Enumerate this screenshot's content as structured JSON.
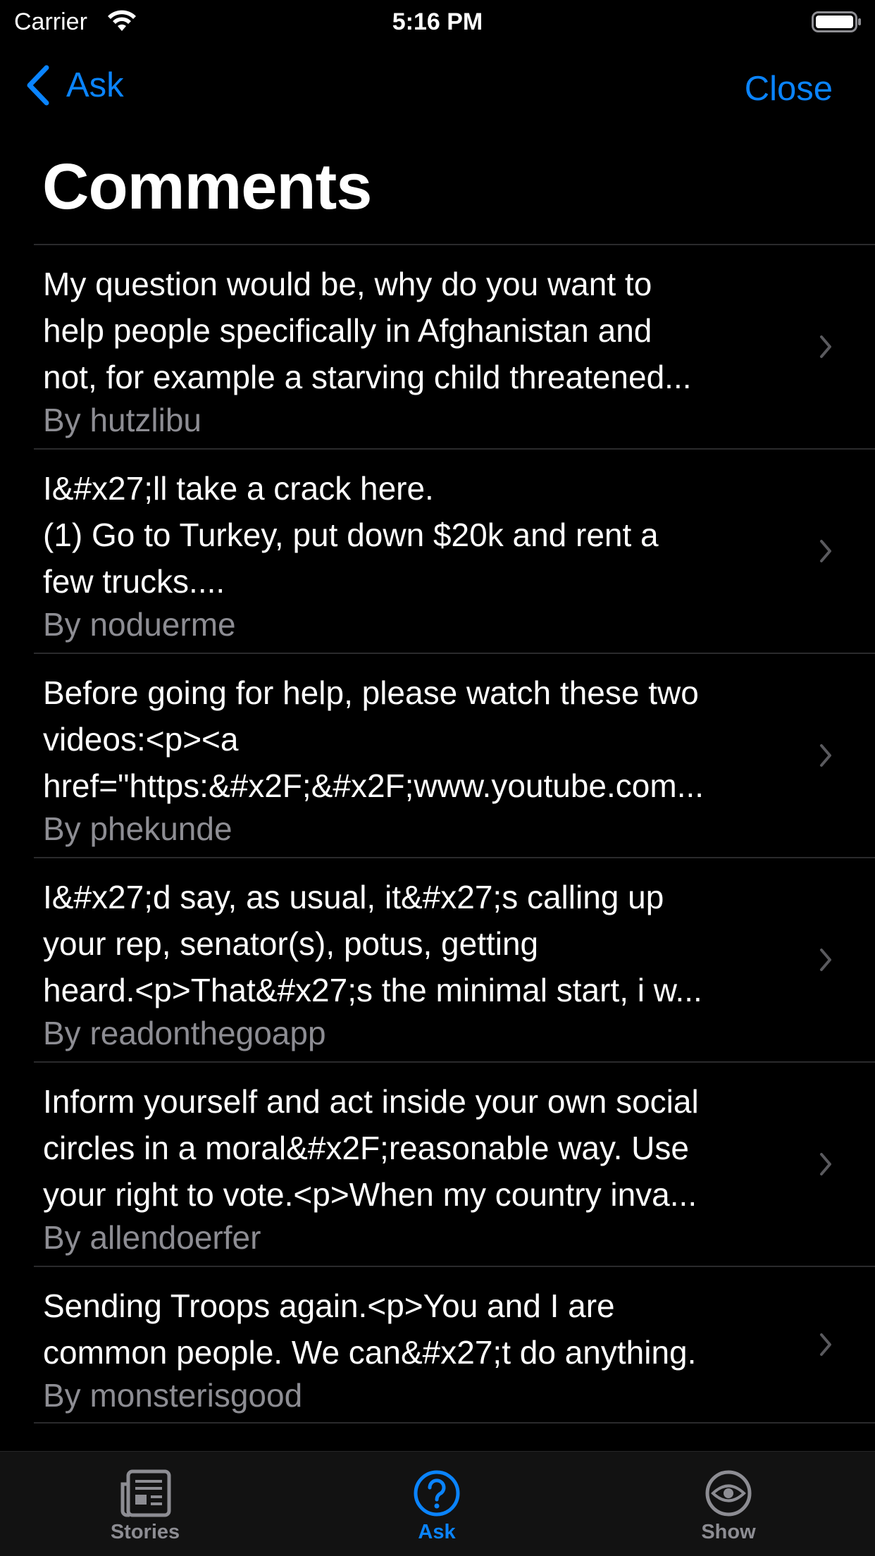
{
  "status_bar": {
    "carrier": "Carrier",
    "time": "5:16 PM"
  },
  "nav": {
    "back_label": "Ask",
    "close_label": "Close",
    "title": "Comments"
  },
  "comments": [
    {
      "text": "My question would be, why do you want to\nhelp people specifically in Afghanistan and\nnot, for example a starving child threatened...",
      "author": "By hutzlibu"
    },
    {
      "text": "I&#x27;ll take a crack here.\n(1) Go to Turkey, put down $20k and rent a\nfew trucks....",
      "author": "By noduerme"
    },
    {
      "text": "Before going for help, please watch these two\nvideos:<p><a\nhref=\"https:&#x2F;&#x2F;www.youtube.com...",
      "author": "By phekunde"
    },
    {
      "text": "I&#x27;d say, as usual, it&#x27;s calling up\nyour rep, senator(s), potus, getting\nheard.<p>That&#x27;s the minimal start, i w...",
      "author": "By readonthegoapp"
    },
    {
      "text": "Inform yourself and act inside your own social\ncircles in a moral&#x2F;reasonable way. Use\nyour right to vote.<p>When my country inva...",
      "author": "By allendoerfer"
    },
    {
      "text": "Sending Troops again.<p>You and I are\ncommon people. We can&#x27;t do anything.",
      "author": "By monsterisgood"
    }
  ],
  "tabs": [
    {
      "label": "Stories",
      "icon": "newspaper-icon",
      "selected": false
    },
    {
      "label": "Ask",
      "icon": "question-circle-icon",
      "selected": true
    },
    {
      "label": "Show",
      "icon": "eye-icon",
      "selected": false
    }
  ],
  "colors": {
    "accent": "#0a84ff",
    "background": "#000000",
    "secondary_text": "#8d8d93",
    "tab_inactive": "#8d8d93"
  }
}
